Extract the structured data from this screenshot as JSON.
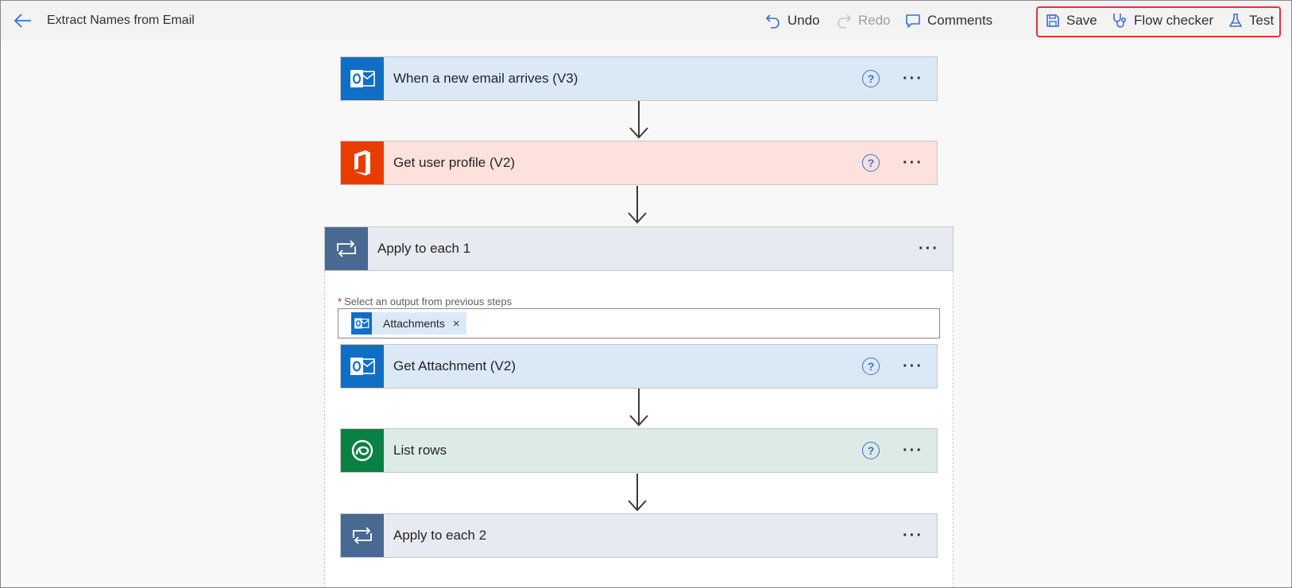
{
  "header": {
    "title": "Extract Names from Email",
    "undo_label": "Undo",
    "redo_label": "Redo",
    "comments_label": "Comments",
    "save_label": "Save",
    "flow_checker_label": "Flow checker",
    "test_label": "Test",
    "accent_color": "#3c6fd6",
    "highlight_color": "#e0343d"
  },
  "steps": {
    "trigger": {
      "title": "When a new email arrives (V3)",
      "icon": "outlook-icon",
      "color": "#0f6fc6"
    },
    "get_profile": {
      "title": "Get user profile (V2)",
      "icon": "office-icon",
      "color": "#eb3c00"
    },
    "apply1": {
      "title": "Apply to each 1",
      "icon": "loop-icon",
      "color": "#486991",
      "field_label": "Select an output from previous steps",
      "required_marker": "*",
      "token_label": "Attachments",
      "token_close": "×"
    },
    "get_attachment": {
      "title": "Get Attachment (V2)",
      "icon": "outlook-icon",
      "color": "#0f6fc6"
    },
    "list_rows": {
      "title": "List rows",
      "icon": "dataverse-icon",
      "color": "#088142"
    },
    "apply2": {
      "title": "Apply to each 2",
      "icon": "loop-icon",
      "color": "#486991"
    }
  },
  "common": {
    "help_glyph": "?",
    "more_glyph": "···"
  }
}
